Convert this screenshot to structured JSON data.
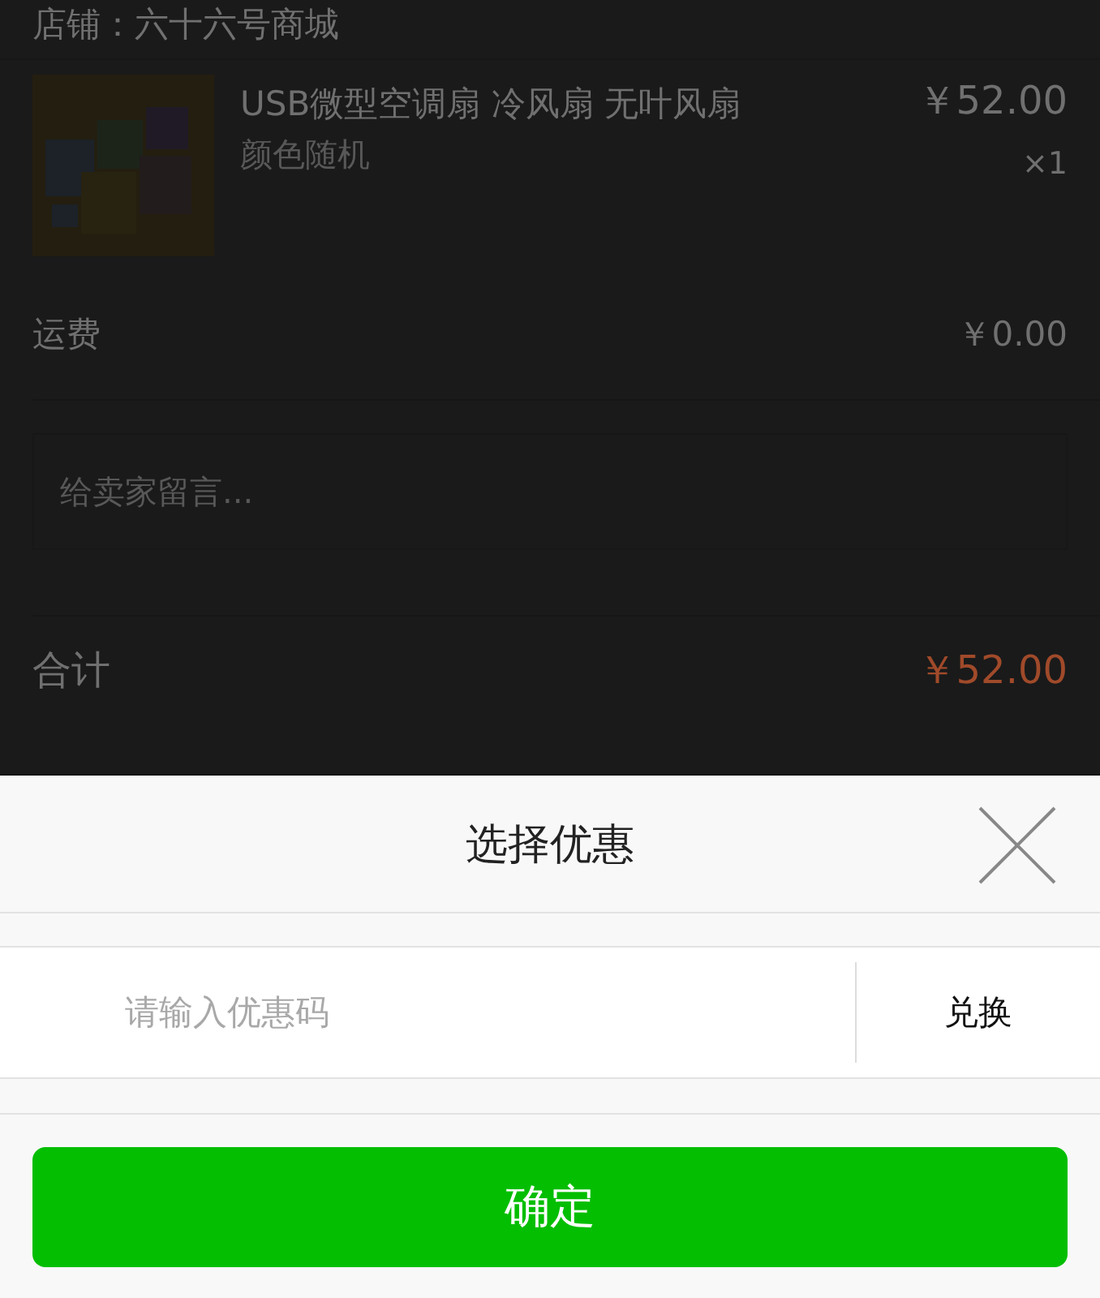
{
  "order": {
    "store": "店铺：六十六号商城",
    "product": {
      "kind": "picture",
      "title": "USB微型空调扇 冷风扇 无叶风扇",
      "variant": "颜色随机",
      "price": "￥52.00",
      "quantity": "×1"
    },
    "shipping": {
      "label": "运费",
      "value": "￥0.00"
    },
    "message": {
      "placeholder": "给卖家留言..."
    },
    "total": {
      "label": "合计",
      "value": "￥52.00"
    },
    "dimmed": true
  },
  "sheet": {
    "title": "选择优惠",
    "coupon": {
      "placeholder": "请输入优惠码"
    },
    "redeem": "兑换",
    "confirm": "确定"
  }
}
